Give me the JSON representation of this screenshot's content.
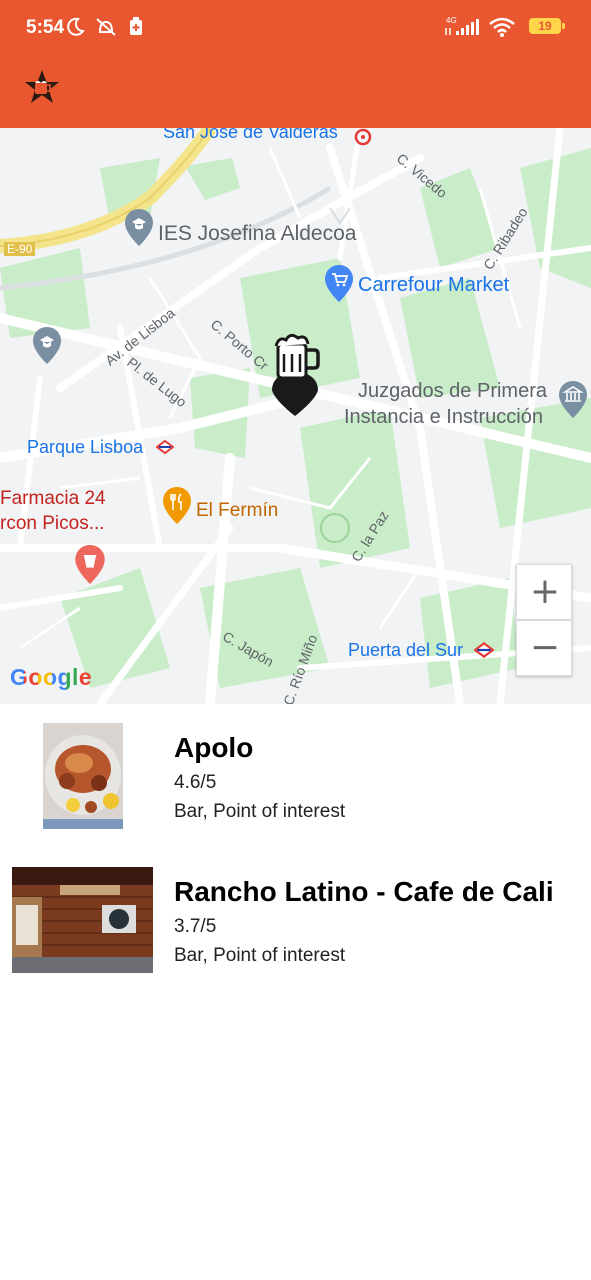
{
  "status_bar": {
    "time": "5:54",
    "network": "4G",
    "battery": "19"
  },
  "app": {
    "accent_color": "#E95731",
    "logo_icon": "beer-star-logo-icon"
  },
  "map": {
    "labels": {
      "san_jose": "San José de Valderas",
      "vicedo": "C. Vicedo",
      "ies": "IES Josefina Aldecoa",
      "ribadeo": "C. Ribadeo",
      "e90": "E-90",
      "carrefour": "Carrefour Market",
      "av_lisboa": "Av. de Lisboa",
      "porto": "C. Porto Cr",
      "pl_lugo": "Pl. de Lugo",
      "juzgados_1": "Juzgados de Primera",
      "juzgados_2": "Instancia e Instrucción",
      "parque_lisboa": "Parque Lisboa",
      "farmacia_1": "Farmacia 24",
      "farmacia_2": "rcon Picos...",
      "el_fermin": "El Fermín",
      "la_paz": "C. la Paz",
      "japon": "C. Japón",
      "rio_mino": "C. Río Miño",
      "puerta_sur": "Puerta del Sur"
    },
    "zoom_in": "+",
    "zoom_out": "−",
    "attribution": "Google"
  },
  "results": [
    {
      "name": "Apolo",
      "rating": "4.6/5",
      "types": "Bar, Point of interest"
    },
    {
      "name": "Rancho Latino - Cafe de Cali",
      "rating": "3.7/5",
      "types": "Bar, Point of interest"
    }
  ]
}
